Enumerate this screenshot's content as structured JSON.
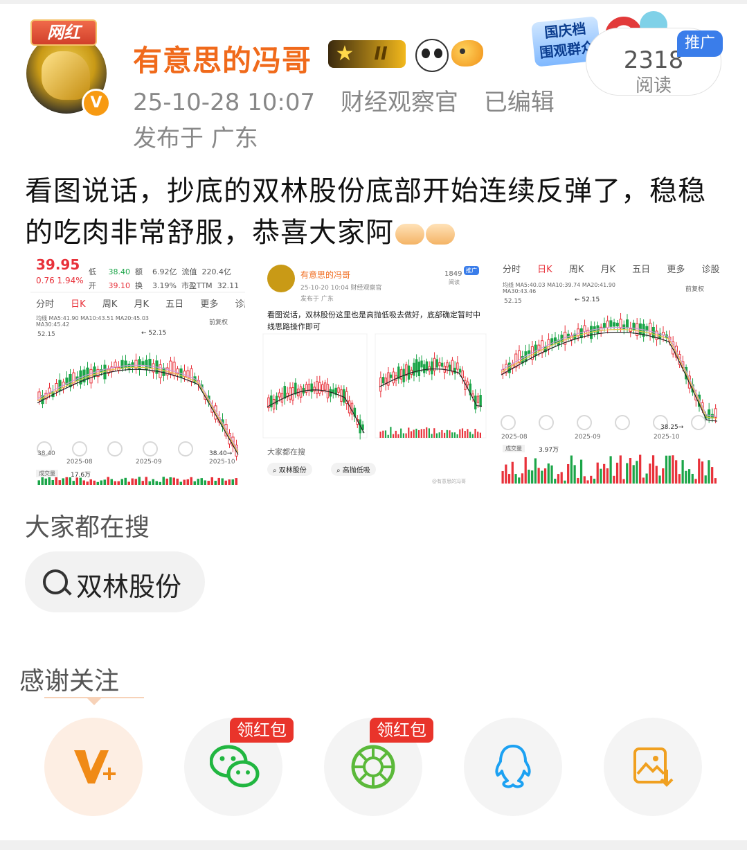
{
  "user": {
    "name": "有意思的冯哥",
    "badge": "网红",
    "level": "II",
    "verified_mark": "V"
  },
  "post_meta": {
    "time": "25-10-28 10:07",
    "source": "财经观察官",
    "edited": "已编辑",
    "location": "发布于 广东"
  },
  "promo": {
    "line1": "国庆档",
    "line2": "围观群众"
  },
  "reads": {
    "count": "2318",
    "label": "阅读",
    "ad_label": "推广"
  },
  "post_text": "看图说话，抄底的双林股份底部开始连续反弹了，稳稳的吃肉非常舒服，恭喜大家阿",
  "images": [
    {
      "price": "39.95",
      "change": "0.76 1.94%",
      "row1": [
        "低",
        "38.40",
        "额",
        "6.92亿",
        "流值",
        "220.4亿"
      ],
      "row2": [
        "开",
        "39.10",
        "换",
        "3.19%",
        "市盈TTM",
        "32.11"
      ],
      "tabs": [
        "分时",
        "日K",
        "周K",
        "月K",
        "五日",
        "更多",
        "诊股"
      ],
      "ma_line1": "均线  MA5:41.90  MA10:43.51  MA20:45.03",
      "ma_line2": "MA30:45.42",
      "adjust": "前复权",
      "high": "52.15",
      "high_arrow": "52.15",
      "low": "38.40",
      "low_arrow": "38.40",
      "dates": [
        "2025-08",
        "2025-09",
        "2025-10"
      ],
      "volume_label": "成交量",
      "volume_value": "17.6万"
    },
    {
      "name": "有意思的冯哥",
      "time": "25-10-20 10:04  财经观察官",
      "location": "发布于 广东",
      "reads": "1849",
      "reads_label": "阅读",
      "ad": "推广",
      "text": "看图说话，双林股份这里也是高抛低吸去做好，底部确定暂时中线思路操作即可",
      "search_head": "大家都在搜",
      "chips": [
        "双林股份",
        "高抛低吸"
      ],
      "watermark": "@有意思的冯哥"
    },
    {
      "tabs": [
        "分时",
        "日K",
        "周K",
        "月K",
        "五日",
        "更多",
        "诊股"
      ],
      "ma_line1": "均线  MA5:40.03  MA10:39.74  MA20:41.90",
      "ma_line2": "MA30:43.46",
      "adjust": "前复权",
      "high": "52.15",
      "low": "38.25",
      "dates": [
        "2025-08",
        "2025-09",
        "2025-10"
      ],
      "volume_label": "成交量",
      "volume_value": "3.97万"
    }
  ],
  "search": {
    "heading": "大家都在搜",
    "chip": "双林股份"
  },
  "follow": {
    "thanks": "感谢关注"
  },
  "share": {
    "buttons": [
      "follow-v",
      "wechat",
      "moments",
      "qq",
      "save-image"
    ],
    "hongbao": "领红包"
  },
  "colors": {
    "username": "#f06a1b",
    "accent_red": "#e9342b",
    "ad_blue": "#3a7dea",
    "up": "#e8313a",
    "down": "#1ba548"
  }
}
